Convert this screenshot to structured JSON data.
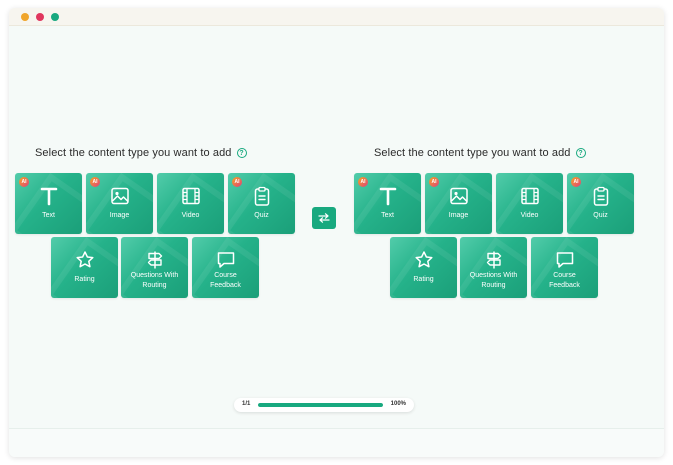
{
  "window_controls": {
    "colors": [
      "#f0a52b",
      "#e0365e",
      "#19a87f"
    ]
  },
  "panels": [
    {
      "title": "Select the content type you want to add",
      "help_icon": "?",
      "tiles": [
        {
          "label": "Text",
          "icon": "text-icon",
          "ai": true
        },
        {
          "label": "Image",
          "icon": "image-icon",
          "ai": true
        },
        {
          "label": "Video",
          "icon": "video-icon",
          "ai": false
        },
        {
          "label": "Quiz",
          "icon": "clipboard-icon",
          "ai": true
        },
        {
          "label": "Rating",
          "icon": "star-icon",
          "ai": false
        },
        {
          "label": "Questions With Routing",
          "icon": "signpost-icon",
          "ai": false
        },
        {
          "label": "Course Feedback",
          "icon": "speech-bubble-icon",
          "ai": false
        }
      ]
    },
    {
      "title": "Select the content type you want to add",
      "help_icon": "?",
      "tiles": [
        {
          "label": "Text",
          "icon": "text-icon",
          "ai": true
        },
        {
          "label": "Image",
          "icon": "image-icon",
          "ai": true
        },
        {
          "label": "Video",
          "icon": "video-icon",
          "ai": false
        },
        {
          "label": "Quiz",
          "icon": "clipboard-icon",
          "ai": true
        },
        {
          "label": "Rating",
          "icon": "star-icon",
          "ai": false
        },
        {
          "label": "Questions With Routing",
          "icon": "signpost-icon",
          "ai": false
        },
        {
          "label": "Course Feedback",
          "icon": "speech-bubble-icon",
          "ai": false
        }
      ]
    }
  ],
  "ai_badge": "AI",
  "swap_button": {
    "icon": "swap-arrows-icon"
  },
  "progress": {
    "page": "1/1",
    "percent_label": "100%",
    "fraction": 1.0
  },
  "colors": {
    "accent": "#18a97f"
  }
}
